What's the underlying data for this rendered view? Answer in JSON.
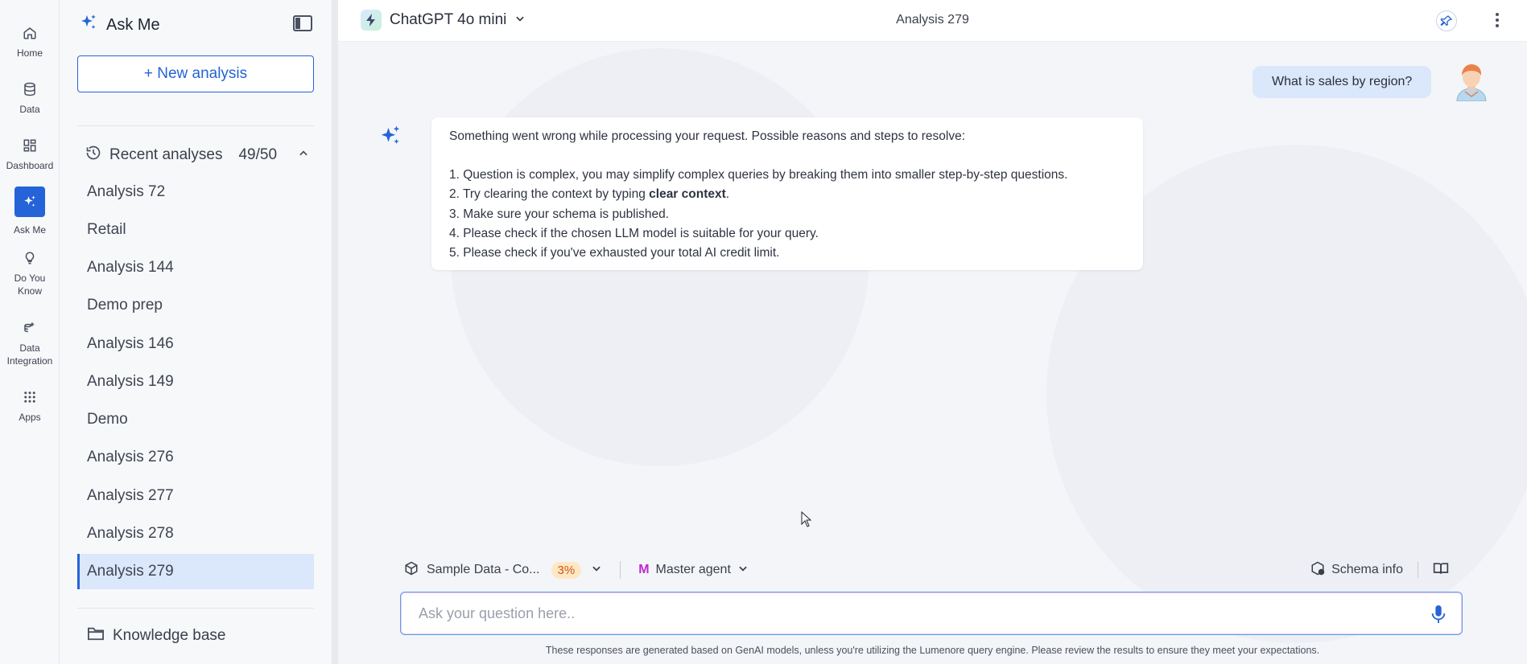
{
  "rail": {
    "items": [
      {
        "label": "Home",
        "icon": "home-icon"
      },
      {
        "label": "Data",
        "icon": "database-icon"
      },
      {
        "label": "Dashboard",
        "icon": "dashboard-icon"
      },
      {
        "label": "Ask Me",
        "icon": "sparkle-icon",
        "active": true
      },
      {
        "label_line1": "Do You",
        "label_line2": "Know",
        "icon": "lightbulb-icon"
      },
      {
        "label_line1": "Data",
        "label_line2": "Integration",
        "icon": "data-integration-icon"
      },
      {
        "label": "Apps",
        "icon": "apps-grid-icon"
      }
    ]
  },
  "sidebar": {
    "title": "Ask Me",
    "new_analysis_label": "+ New analysis",
    "recent_label": "Recent analyses",
    "recent_count": "49/50",
    "analyses": [
      "Analysis 72",
      "Retail",
      "Analysis 144",
      "Demo prep",
      "Analysis 146",
      "Analysis 149",
      "Demo",
      "Analysis 276",
      "Analysis 277",
      "Analysis 278",
      "Analysis 279"
    ],
    "selected": "Analysis 279",
    "knowledge_base_label": "Knowledge base"
  },
  "topbar": {
    "model_name": "ChatGPT 4o mini",
    "title": "Analysis 279"
  },
  "conversation": {
    "user_message": "What is sales by region?",
    "ai_intro": "Something went wrong while processing your request. Possible reasons and steps to resolve:",
    "ai_steps": [
      "1. Question is complex, you may simplify complex queries by breaking them into smaller step-by-step questions.",
      "3. Make sure your schema is published.",
      "4. Please check if the chosen LLM model is suitable for your query.",
      "5. Please check if you've exhausted your total AI credit limit."
    ],
    "ai_step2_prefix": "2. Try clearing the context by typing ",
    "ai_step2_bold": "clear context",
    "ai_step2_suffix": "."
  },
  "controls": {
    "dataset_label": "Sample Data - Co...",
    "dataset_usage": "3%",
    "agent_initial": "M",
    "agent_label": "Master agent",
    "schema_info_label": "Schema info"
  },
  "input": {
    "placeholder": "Ask your question here.."
  },
  "footer": {
    "disclaimer": "These responses are generated based on GenAI models, unless you're utilizing the Lumenore query engine. Please review the results to ensure they meet your expectations."
  },
  "colors": {
    "accent": "#2563d8",
    "selected_bg": "#dbe7fb",
    "badge_bg": "#fde8c3",
    "badge_text": "#d0561a",
    "agent_m": "#c026d3"
  }
}
